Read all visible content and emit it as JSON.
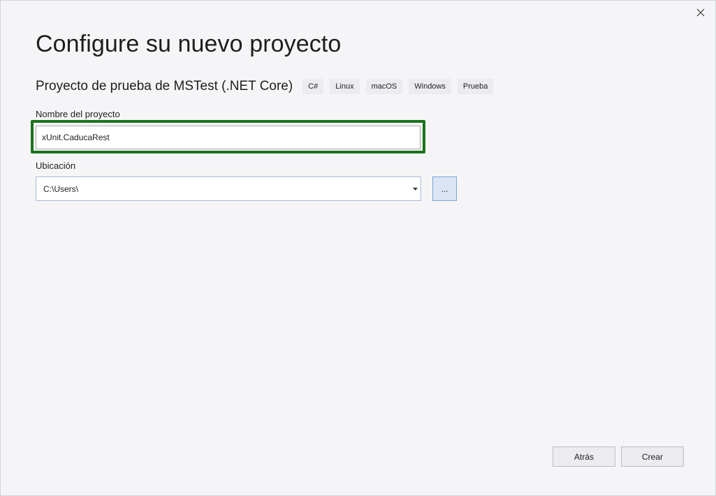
{
  "window": {
    "close_icon": "close-icon"
  },
  "header": {
    "title": "Configure su nuevo proyecto"
  },
  "template": {
    "name": "Proyecto de prueba de MSTest (.NET Core)",
    "tags": [
      "C#",
      "Linux",
      "macOS",
      "Windows",
      "Prueba"
    ]
  },
  "form": {
    "project_name": {
      "label": "Nombre del proyecto",
      "value": "xUnit.CaducaRest"
    },
    "location": {
      "label": "Ubicación",
      "value": "C:\\Users\\",
      "dropdown_icon": "chevron-down-icon",
      "browse_label": "..."
    }
  },
  "footer": {
    "back_label": "Atrás",
    "create_label": "Crear"
  },
  "colors": {
    "highlight": "#1a731d",
    "dialog_background": "#f5f5f7",
    "browse_button": "#dbe5f5"
  }
}
